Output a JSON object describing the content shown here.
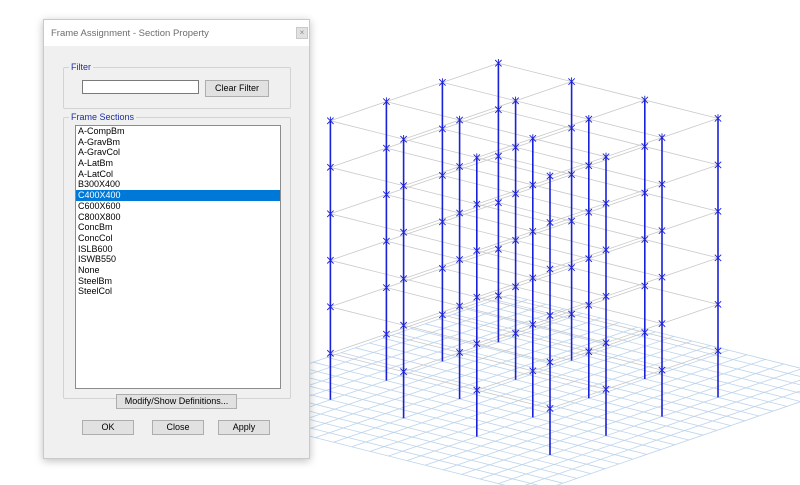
{
  "dialog": {
    "title": "Frame Assignment - Section Property",
    "close_glyph": "×",
    "filter": {
      "group_label": "Filter",
      "input_value": "",
      "clear_label": "Clear Filter"
    },
    "sections": {
      "group_label": "Frame Sections",
      "items": [
        "A-CompBm",
        "A-GravBm",
        "A-GravCol",
        "A-LatBm",
        "A-LatCol",
        "B300X400",
        "C400X400",
        "C600X600",
        "C800X800",
        "ConcBm",
        "ConcCol",
        "ISLB600",
        "ISWB550",
        "None",
        "SteelBm",
        "SteelCol"
      ],
      "selected": "C400X400"
    },
    "buttons": {
      "modify": "Modify/Show Definitions...",
      "ok": "OK",
      "close": "Close",
      "apply": "Apply"
    }
  },
  "colors": {
    "column": "#1a1fd8",
    "grid": "#bcd4ec",
    "beam": "#c9c9c9",
    "selection": "#0078d7"
  }
}
